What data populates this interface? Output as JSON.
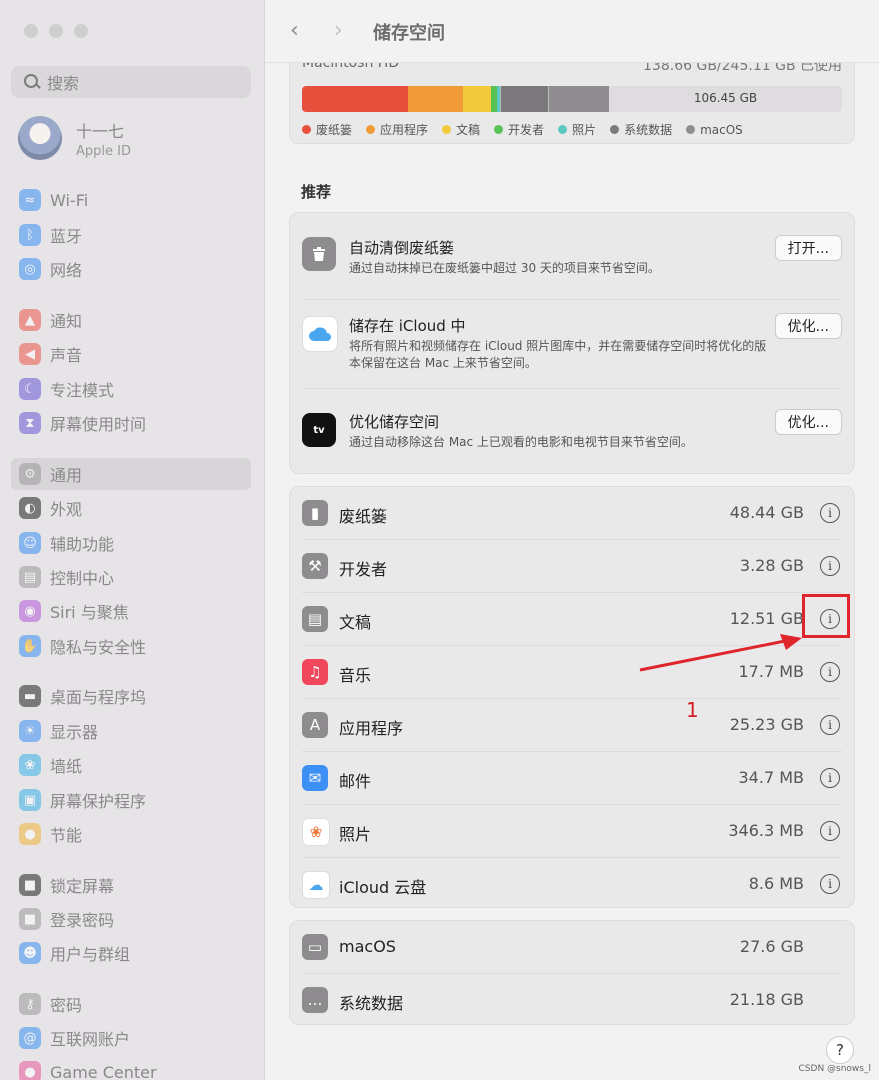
{
  "sidebar": {
    "search_placeholder": "搜索",
    "user": {
      "name": "十一七",
      "subtitle": "Apple ID"
    },
    "items": [
      {
        "label": "Wi-Fi",
        "icon": "wifi-icon",
        "color": "#3b8ff5"
      },
      {
        "label": "蓝牙",
        "icon": "bluetooth-icon",
        "color": "#3b8ff5"
      },
      {
        "label": "网络",
        "icon": "globe-icon",
        "color": "#3b8ff5"
      },
      {
        "label": "通知",
        "icon": "bell-icon",
        "color": "#f0554b"
      },
      {
        "label": "声音",
        "icon": "speaker-icon",
        "color": "#f0554b"
      },
      {
        "label": "专注模式",
        "icon": "moon-icon",
        "color": "#6a5ad6"
      },
      {
        "label": "屏幕使用时间",
        "icon": "hourglass-icon",
        "color": "#6a5ad6"
      },
      {
        "label": "通用",
        "icon": "gear-icon",
        "color": "#9a989a"
      },
      {
        "label": "外观",
        "icon": "appearance-icon",
        "color": "#222222"
      },
      {
        "label": "辅助功能",
        "icon": "accessibility-icon",
        "color": "#3b8ff5"
      },
      {
        "label": "控制中心",
        "icon": "toggles-icon",
        "color": "#9a989a"
      },
      {
        "label": "Siri 与聚焦",
        "icon": "siri-icon",
        "color": "#b45adb"
      },
      {
        "label": "隐私与安全性",
        "icon": "hand-icon",
        "color": "#3b8ff5"
      },
      {
        "label": "桌面与程序坞",
        "icon": "dock-icon",
        "color": "#222222"
      },
      {
        "label": "显示器",
        "icon": "sun-icon",
        "color": "#3b8ff5"
      },
      {
        "label": "墙纸",
        "icon": "flower-icon",
        "color": "#3bb0e8"
      },
      {
        "label": "屏幕保护程序",
        "icon": "screensaver-icon",
        "color": "#3bb0e8"
      },
      {
        "label": "节能",
        "icon": "bulb-icon",
        "color": "#f3b43a"
      },
      {
        "label": "锁定屏幕",
        "icon": "lock-screen-icon",
        "color": "#222222"
      },
      {
        "label": "登录密码",
        "icon": "lock-icon",
        "color": "#9a989a"
      },
      {
        "label": "用户与群组",
        "icon": "users-icon",
        "color": "#3b8ff5"
      },
      {
        "label": "密码",
        "icon": "key-icon",
        "color": "#9a989a"
      },
      {
        "label": "互联网账户",
        "icon": "at-icon",
        "color": "#3b8ff5"
      },
      {
        "label": "Game Center",
        "icon": "game-center-icon",
        "color": "#e85a9a"
      }
    ]
  },
  "titlebar": {
    "title": "储存空间"
  },
  "storage": {
    "disk_name": "Macintosh HD",
    "used_text": "138.66 GB/245.11 GB 已使用",
    "free_label": "106.45 GB",
    "legend": [
      {
        "label": "废纸篓",
        "color": "#e8503e"
      },
      {
        "label": "应用程序",
        "color": "#f09a38"
      },
      {
        "label": "文稿",
        "color": "#f3c93c"
      },
      {
        "label": "开发者",
        "color": "#57c357"
      },
      {
        "label": "照片",
        "color": "#5cc9c0"
      },
      {
        "label": "系统数据",
        "color": "#7b797b"
      },
      {
        "label": "macOS",
        "color": "#8f8d8f"
      }
    ]
  },
  "recommend": {
    "title": "推荐",
    "items": [
      {
        "title": "自动清倒废纸篓",
        "desc": "通过自动抹掉已在废纸篓中超过 30 天的项目来节省空间。",
        "button": "打开..."
      },
      {
        "title": "储存在 iCloud 中",
        "desc": "将所有照片和视频储存在 iCloud 照片图库中，并在需要储存空间时将优化的版本保留在这台 Mac 上来节省空间。",
        "button": "优化..."
      },
      {
        "title": "优化储存空间",
        "desc": "通过自动移除这台 Mac 上已观看的电影和电视节目来节省空间。",
        "button": "优化..."
      }
    ]
  },
  "categories": [
    {
      "name": "废纸篓",
      "size": "48.44 GB",
      "icon": "trash-icon"
    },
    {
      "name": "开发者",
      "size": "3.28 GB",
      "icon": "hammer-icon"
    },
    {
      "name": "文稿",
      "size": "12.51 GB",
      "icon": "document-icon"
    },
    {
      "name": "音乐",
      "size": "17.7 MB",
      "icon": "music-icon"
    },
    {
      "name": "应用程序",
      "size": "25.23 GB",
      "icon": "app-store-icon"
    },
    {
      "name": "邮件",
      "size": "34.7 MB",
      "icon": "mail-icon"
    },
    {
      "name": "照片",
      "size": "346.3 MB",
      "icon": "photos-icon"
    },
    {
      "name": "iCloud 云盘",
      "size": "8.6 MB",
      "icon": "icloud-icon"
    }
  ],
  "system": [
    {
      "name": "macOS",
      "size": "27.6 GB",
      "icon": "drive-icon"
    },
    {
      "name": "系统数据",
      "size": "21.18 GB",
      "icon": "ellipsis-icon"
    }
  ],
  "annotation": {
    "number": "1"
  },
  "watermark": "CSDN @snows_l"
}
